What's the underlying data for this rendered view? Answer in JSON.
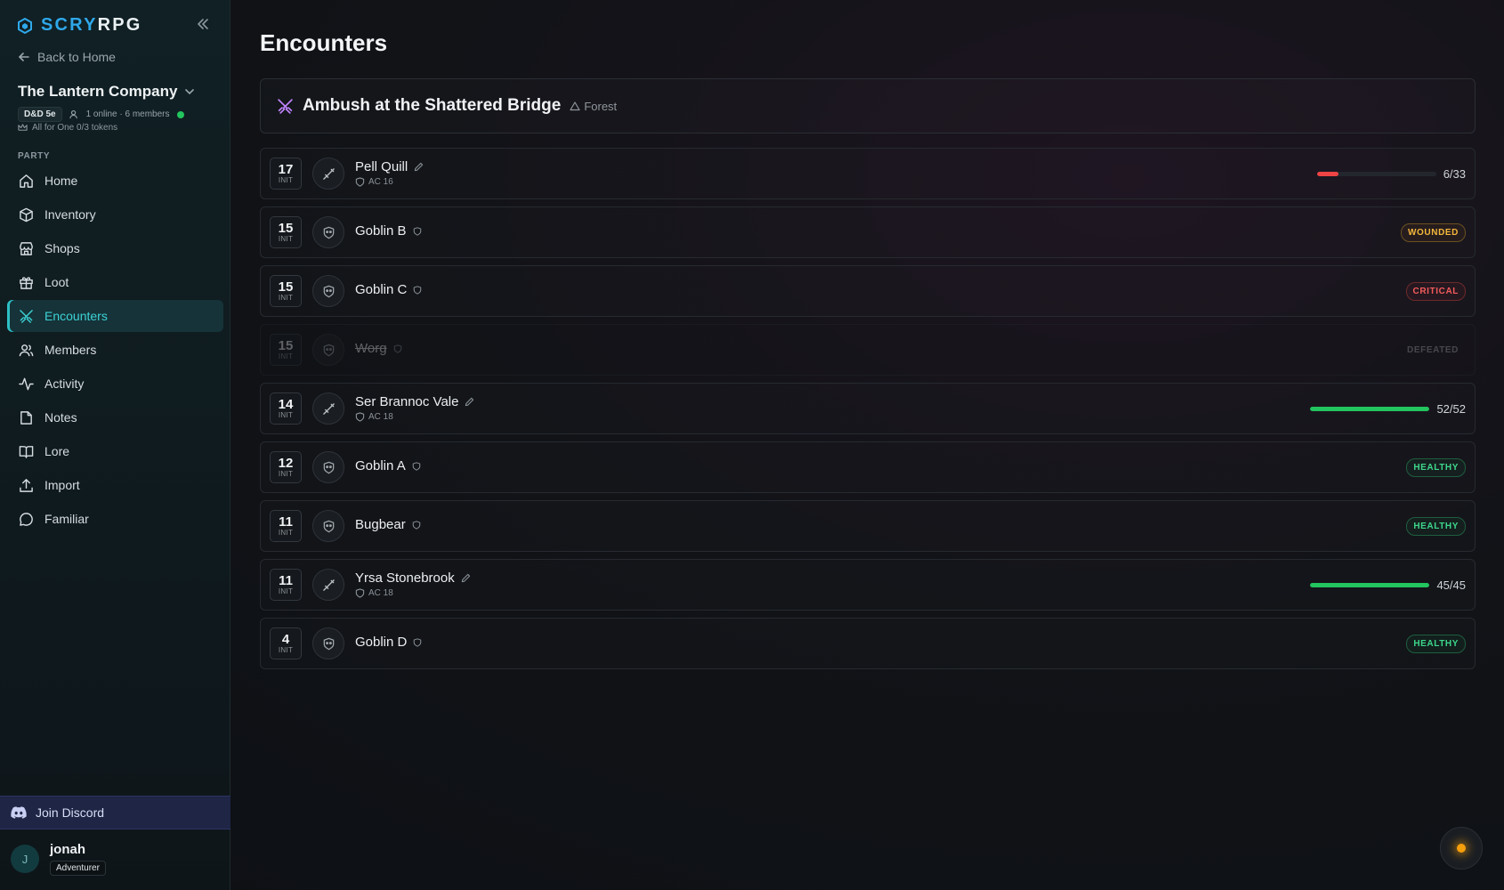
{
  "brand": {
    "part1": "SCRY",
    "part2": "RPG"
  },
  "sidebar": {
    "back_label": "Back to Home",
    "campaign_name": "The Lantern Company",
    "system_badge": "D&D 5e",
    "presence": "1 online · 6 members",
    "tokens": "All for One 0/3 tokens",
    "section_label": "PARTY",
    "nav": [
      {
        "label": "Home",
        "icon": "home-icon"
      },
      {
        "label": "Inventory",
        "icon": "box-icon"
      },
      {
        "label": "Shops",
        "icon": "store-icon"
      },
      {
        "label": "Loot",
        "icon": "gift-icon"
      },
      {
        "label": "Encounters",
        "icon": "crossed-swords-icon",
        "active": true
      },
      {
        "label": "Members",
        "icon": "users-icon"
      },
      {
        "label": "Activity",
        "icon": "activity-icon"
      },
      {
        "label": "Notes",
        "icon": "note-icon"
      },
      {
        "label": "Lore",
        "icon": "book-icon"
      },
      {
        "label": "Import",
        "icon": "upload-icon"
      },
      {
        "label": "Familiar",
        "icon": "chat-icon"
      }
    ],
    "discord_label": "Join Discord",
    "user": {
      "initial": "J",
      "name": "jonah",
      "role": "Adventurer"
    }
  },
  "main": {
    "title": "Encounters",
    "encounter": {
      "title": "Ambush at the Shattered Bridge",
      "terrain": "Forest"
    },
    "init_label": "INIT",
    "combatants": [
      {
        "init": "17",
        "name": "Pell Quill",
        "kind": "pc",
        "ac": "AC 16",
        "hp_text": "6/33",
        "hp_fraction": 0.18,
        "hp_color": "#ef4444"
      },
      {
        "init": "15",
        "name": "Goblin B",
        "kind": "npc",
        "status": "WOUNDED",
        "status_kind": "wounded"
      },
      {
        "init": "15",
        "name": "Goblin C",
        "kind": "npc",
        "status": "CRITICAL",
        "status_kind": "critical"
      },
      {
        "init": "15",
        "name": "Worg",
        "kind": "npc",
        "status": "DEFEATED",
        "status_kind": "defeated",
        "defeated": true
      },
      {
        "init": "14",
        "name": "Ser Brannoc Vale",
        "kind": "pc",
        "ac": "AC 18",
        "hp_text": "52/52",
        "hp_fraction": 1.0,
        "hp_color": "#22c55e"
      },
      {
        "init": "12",
        "name": "Goblin A",
        "kind": "npc",
        "status": "HEALTHY",
        "status_kind": "healthy"
      },
      {
        "init": "11",
        "name": "Bugbear",
        "kind": "npc",
        "status": "HEALTHY",
        "status_kind": "healthy"
      },
      {
        "init": "11",
        "name": "Yrsa Stonebrook",
        "kind": "pc",
        "ac": "AC 18",
        "hp_text": "45/45",
        "hp_fraction": 1.0,
        "hp_color": "#22c55e"
      },
      {
        "init": "4",
        "name": "Goblin D",
        "kind": "npc",
        "status": "HEALTHY",
        "status_kind": "healthy"
      }
    ]
  },
  "colors": {
    "accent": "#2dbfc5",
    "brand": "#2fa8ea",
    "discord": "#1e2545"
  }
}
